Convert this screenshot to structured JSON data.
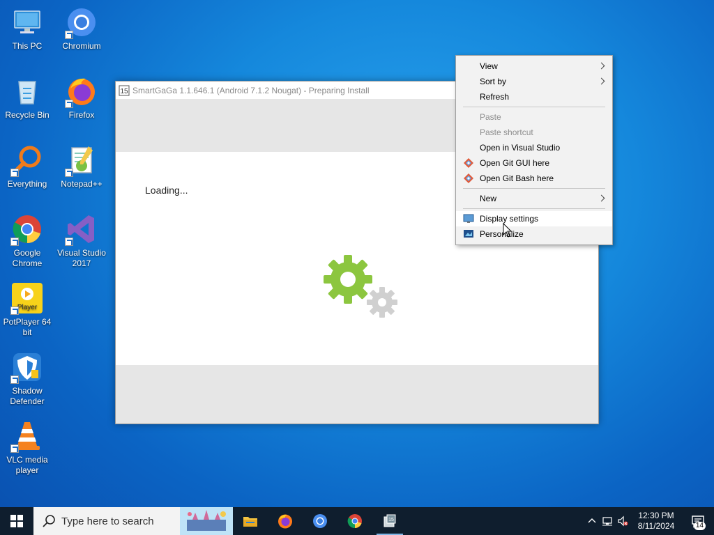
{
  "desktop": {
    "icons": [
      {
        "label": "This PC",
        "icon": "this-pc-icon"
      },
      {
        "label": "Chromium",
        "icon": "chromium-icon"
      },
      {
        "label": "Recycle Bin",
        "icon": "recycle-bin-icon"
      },
      {
        "label": "Firefox",
        "icon": "firefox-icon"
      },
      {
        "label": "Everything",
        "icon": "everything-search-icon"
      },
      {
        "label": "Notepad++",
        "icon": "notepad-plus-plus-icon"
      },
      {
        "label": "Google Chrome",
        "icon": "google-chrome-icon"
      },
      {
        "label": "Visual Studio 2017",
        "icon": "visual-studio-icon"
      },
      {
        "label": "PotPlayer 64 bit",
        "icon": "potplayer-icon"
      },
      {
        "label": "Shadow Defender",
        "icon": "shadow-defender-icon"
      },
      {
        "label": "VLC media player",
        "icon": "vlc-icon"
      }
    ]
  },
  "app_window": {
    "title": "SmartGaGa 1.1.646.1 (Android 7.1.2 Nougat) - Preparing Install",
    "status_text": "Loading...",
    "accent_gear_color": "#8cc63f",
    "secondary_gear_color": "#d0d0d0"
  },
  "context_menu": {
    "items": [
      {
        "label": "View",
        "submenu": true,
        "enabled": true
      },
      {
        "label": "Sort by",
        "submenu": true,
        "enabled": true
      },
      {
        "label": "Refresh",
        "enabled": true
      },
      {
        "label": "Paste",
        "enabled": false
      },
      {
        "label": "Paste shortcut",
        "enabled": false
      },
      {
        "label": "Open in Visual Studio",
        "enabled": true
      },
      {
        "label": "Open Git GUI here",
        "enabled": true,
        "icon": "git-icon"
      },
      {
        "label": "Open Git Bash here",
        "enabled": true,
        "icon": "git-icon"
      },
      {
        "label": "New",
        "submenu": true,
        "enabled": true
      },
      {
        "label": "Display settings",
        "enabled": true,
        "icon": "display-icon",
        "highlighted": true
      },
      {
        "label": "Personalize",
        "enabled": true,
        "icon": "personalize-icon"
      }
    ]
  },
  "taskbar": {
    "search_placeholder": "Type here to search",
    "pinned_apps": [
      "file-explorer-icon",
      "firefox-icon",
      "chromium-icon",
      "google-chrome-icon",
      "smartgaga-icon"
    ],
    "clock_time": "12:30 PM",
    "clock_date": "8/11/2024",
    "notification_count": "14"
  },
  "colors": {
    "taskbar_bg": "#0f1e2e",
    "desktop_bg": "#1588dc",
    "menu_bg": "#f2f2f2"
  }
}
